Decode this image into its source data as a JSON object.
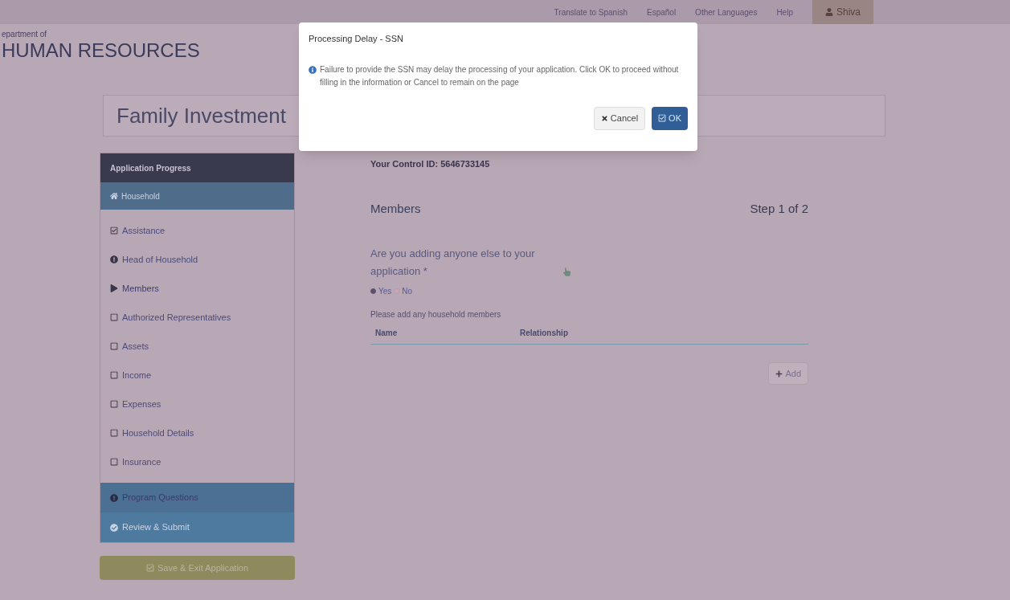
{
  "top_nav": {
    "links": [
      "Translate to Spanish",
      "Español",
      "Other Languages",
      "Help"
    ],
    "user": "Shiva"
  },
  "header": {
    "department": "epartment of",
    "title": "HUMAN RESOURCES"
  },
  "page_title": "Family Investment",
  "sidebar": {
    "heading": "Application Progress",
    "section": {
      "label": "Household",
      "selected": true
    },
    "items": [
      {
        "label": "Assistance",
        "kind": "done"
      },
      {
        "label": "Head of Household",
        "kind": "warning"
      },
      {
        "label": "Members",
        "kind": "current"
      },
      {
        "label": "Authorized Representatives",
        "kind": "todo"
      },
      {
        "label": "Assets",
        "kind": "todo"
      },
      {
        "label": "Income",
        "kind": "todo"
      },
      {
        "label": "Expenses",
        "kind": "todo"
      },
      {
        "label": "Household Details",
        "kind": "todo"
      },
      {
        "label": "Insurance",
        "kind": "todo"
      }
    ],
    "sections": [
      {
        "label": "Program Questions",
        "kind": "warning"
      },
      {
        "label": "Review & Submit",
        "kind": "done"
      }
    ],
    "save_button": "Save & Exit Application"
  },
  "main": {
    "control_id": "Your Control ID: 5646733145",
    "heading": "Members",
    "step": "Step 1 of 2",
    "question": "Are you adding anyone else to your application *",
    "options": [
      {
        "label": "Yes",
        "selected": true
      },
      {
        "label": "No",
        "selected": false
      }
    ],
    "hint": "Please add any household members",
    "table": {
      "columns": [
        "Name",
        "Relationship"
      ]
    },
    "add_button": "Add"
  },
  "dialog": {
    "title": "Processing Delay - SSN",
    "message": "Failure to provide the SSN may delay the processing of your application. Click OK to proceed without filling in the information or Cancel to remain on the page",
    "buttons": [
      {
        "label": "Cancel",
        "kind": "cancel"
      },
      {
        "label": "OK",
        "kind": "ok"
      }
    ]
  }
}
